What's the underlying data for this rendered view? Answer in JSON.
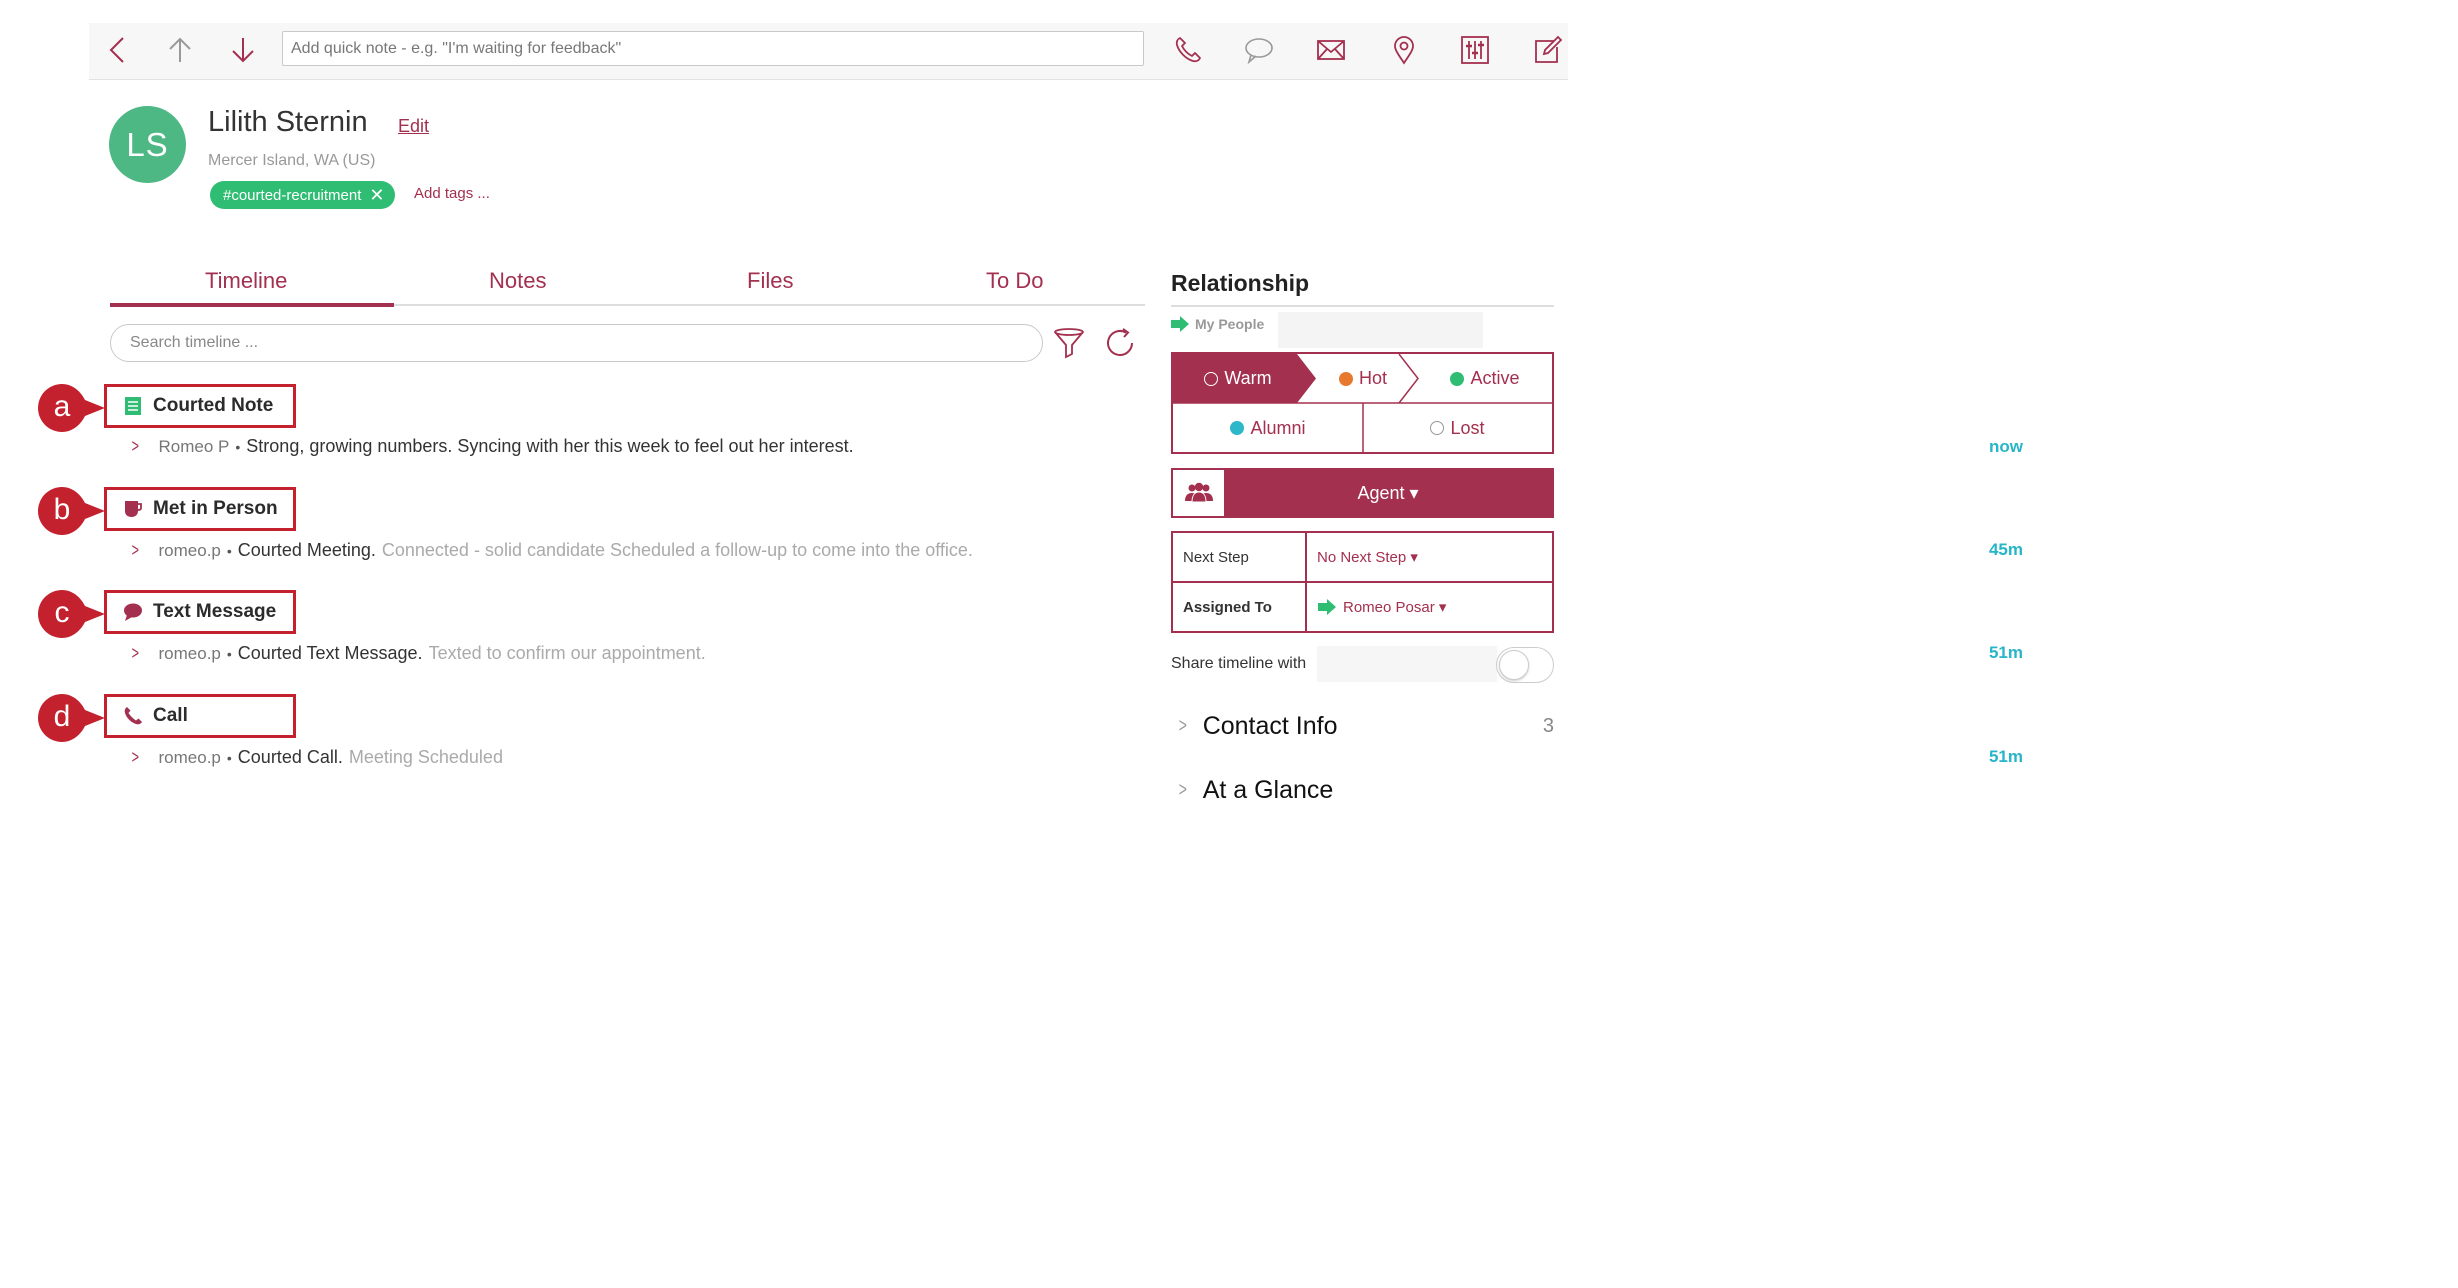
{
  "colors": {
    "accent": "#a3304f",
    "green": "#2ebd72",
    "teal": "#27b5c8",
    "annotation_red": "#c4212e"
  },
  "toolbar": {
    "quick_note_placeholder": "Add quick note - e.g. \"I'm waiting for feedback\"",
    "icons": [
      "back-icon",
      "up-arrow-icon",
      "down-arrow-icon",
      "phone-icon",
      "chat-icon",
      "mail-icon",
      "location-pin-icon",
      "sliders-icon",
      "compose-icon"
    ]
  },
  "contact": {
    "initials": "LS",
    "name": "Lilith Sternin",
    "edit_label": "Edit",
    "location": "Mercer Island, WA (US)",
    "tag": "#courted-recruitment",
    "tag_remove": "✕",
    "add_tags_label": "Add tags ..."
  },
  "tabs": [
    {
      "label": "Timeline",
      "active": true
    },
    {
      "label": "Notes"
    },
    {
      "label": "Files"
    },
    {
      "label": "To Do"
    }
  ],
  "timeline": {
    "search_placeholder": "Search timeline ...",
    "entries": [
      {
        "marker": "a",
        "type": "Courted Note",
        "icon": "note-icon",
        "author": "Romeo P",
        "main": "Strong, growing numbers. Syncing with her this week to feel out her interest.",
        "sub": "",
        "time": "now"
      },
      {
        "marker": "b",
        "type": "Met in Person",
        "icon": "coffee-cup-icon",
        "author": "romeo.p",
        "main": "Courted Meeting.",
        "sub": "Connected - solid candidate Scheduled a follow-up to come into the office.",
        "time": "45m"
      },
      {
        "marker": "c",
        "type": "Text Message",
        "icon": "speech-bubble-icon",
        "author": "romeo.p",
        "main": "Courted Text Message.",
        "sub": "Texted to confirm our appointment.",
        "time": "51m"
      },
      {
        "marker": "d",
        "type": "Call",
        "icon": "phone-icon",
        "author": "romeo.p",
        "main": "Courted Call.",
        "sub": "Meeting Scheduled",
        "time": "51m"
      }
    ]
  },
  "relationship": {
    "title": "Relationship",
    "my_people_label": "My People",
    "statuses": [
      {
        "label": "Warm",
        "dot": "#ffffff",
        "dot_border": "#ffffff",
        "selected": true
      },
      {
        "label": "Hot",
        "dot": "#e8782e"
      },
      {
        "label": "Active",
        "dot": "#2ebd72"
      },
      {
        "label": "Alumni",
        "dot": "#2eb6c9"
      },
      {
        "label": "Lost",
        "dot": "#ffffff",
        "dot_border": "#999999"
      }
    ],
    "agent_label": "Agent ▾",
    "next_step_label": "Next Step",
    "next_step_value": "No Next Step ▾",
    "assigned_label": "Assigned To",
    "assigned_value": "Romeo Posar ▾",
    "share_label": "Share timeline with",
    "share_enabled": false
  },
  "sections": [
    {
      "label": "Contact Info",
      "count": "3"
    },
    {
      "label": "At a Glance",
      "count": ""
    }
  ]
}
